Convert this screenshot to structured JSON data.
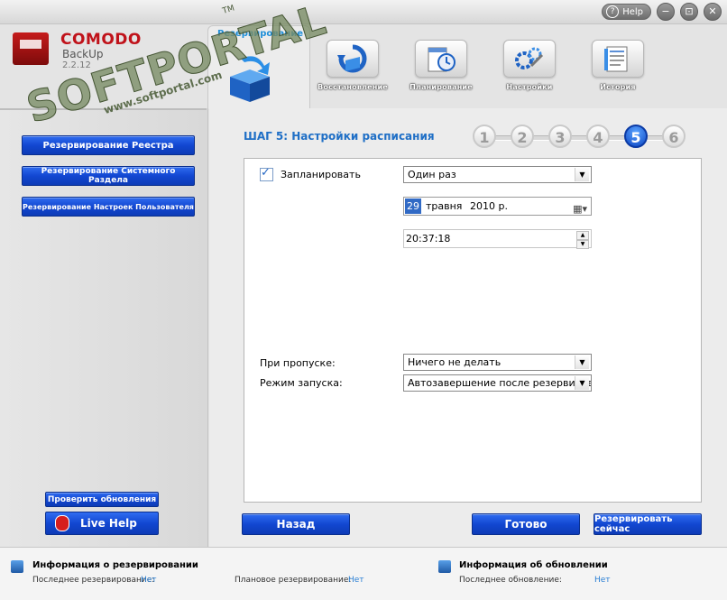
{
  "window": {
    "help_label": "Help",
    "help_glyph": "?",
    "minimize_glyph": "−",
    "maximize_glyph": "⊡",
    "close_glyph": "✕"
  },
  "logo": {
    "brand": "COMODO",
    "product": "BackUp",
    "version": "2.2.12"
  },
  "watermark": {
    "main": "SOFTPORTAL",
    "url": "www.softportal.com",
    "tm": "TM"
  },
  "tabs": {
    "active_label": "Резервирование",
    "items": [
      {
        "label": "Восстановление",
        "icon": "restore-icon"
      },
      {
        "label": "Планирование",
        "icon": "schedule-icon"
      },
      {
        "label": "Настройки",
        "icon": "settings-icon"
      },
      {
        "label": "История",
        "icon": "history-icon"
      }
    ]
  },
  "sidebar": {
    "buttons": [
      "Резервирование Реестра",
      "Резервирование Системного Раздела",
      "Резервирование Настроек Пользователя"
    ],
    "check_updates": "Проверить обновления",
    "live_help": "Live Help"
  },
  "wizard": {
    "title": "ШАГ 5: Настройки расписания",
    "steps": [
      "1",
      "2",
      "3",
      "4",
      "5",
      "6"
    ],
    "current_step": 5,
    "schedule_checkbox_label": "Запланировать",
    "schedule_checked": true,
    "frequency_value": "Один раз",
    "date": {
      "day": "29",
      "month": "травня",
      "year": "2010 р."
    },
    "time_value": "20:37:18",
    "on_skip_label": "При пропуске:",
    "on_skip_value": "Ничего не делать",
    "run_mode_label": "Режим запуска:",
    "run_mode_value": "Автозавершение после резервиров",
    "back_button": "Назад",
    "done_button": "Готово",
    "backup_now_button": "Резервировать сейчас"
  },
  "status": {
    "backup_info_title": "Информация о резервировании",
    "last_backup_label": "Последнее резервирование:",
    "last_backup_value": "Нет",
    "planned_backup_label": "Плановое резервирование:",
    "planned_backup_value": "Нет",
    "update_info_title": "Информация об обновлении",
    "last_update_label": "Последнее обновление:",
    "last_update_value": "Нет"
  },
  "colors": {
    "accent_blue": "#1247d1",
    "title_blue": "#1f6fc6",
    "brand_red": "#c0121a",
    "link_blue": "#2a7fd4"
  }
}
